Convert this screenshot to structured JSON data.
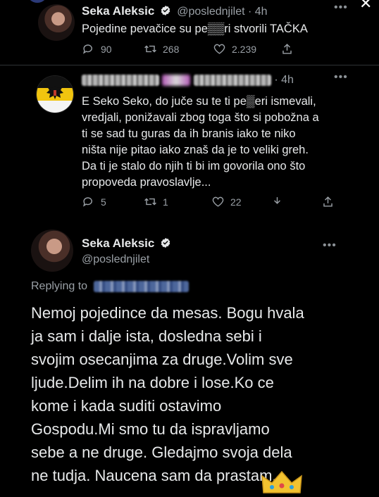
{
  "tweet1": {
    "name": "Seka Aleksic",
    "handle": "@poslednjilet",
    "time": "· 4h",
    "text": "Pojedine pevačice su pe▒▒ri stvorili TAČKA",
    "replies": "90",
    "retweets": "268",
    "likes": "2.239"
  },
  "tweet2": {
    "time": "· 4h",
    "text_lines": [
      "E Seko Seko, do juče su te ti pe▒eri ismevali,",
      "vredjali, ponižavali zbog toga što si pobožna a",
      "ti se sad tu guras da ih branis iako te niko",
      "ništa nije pitao iako znaš da je to veliki greh.",
      "Da ti je stalo do njih ti bi im govorila ono što",
      "propoveda pravoslavlje..."
    ],
    "replies": "5",
    "retweets": "1",
    "likes": "22"
  },
  "main": {
    "name": "Seka Aleksic",
    "handle": "@poslednjilet",
    "replying_to": "Replying to",
    "text_lines": [
      "Nemoj pojedince da mesas. Bogu hvala",
      "ja sam i dalje ista, dosledna sebi i",
      "svojim osecanjima za druge.Volim sve",
      "ljude.Delim ih na dobre i lose.Ko ce",
      "kome i kada suditi ostavimo",
      "Gospodu.Mi smo tu da ispravljamo",
      "sebe a ne druge. Gledajmo svoja dela",
      "ne tudja. Naucena sam da prastam."
    ]
  },
  "colors": {
    "background": "#000000",
    "text": "#e7e9ea",
    "muted": "#9aa0a6",
    "verified": "#e7e9ea",
    "emoji": "#f2c230"
  },
  "icons": [
    "reply-icon",
    "retweet-icon",
    "like-icon",
    "share-icon",
    "more-icon",
    "verified-icon",
    "crown-emoji-icon"
  ]
}
